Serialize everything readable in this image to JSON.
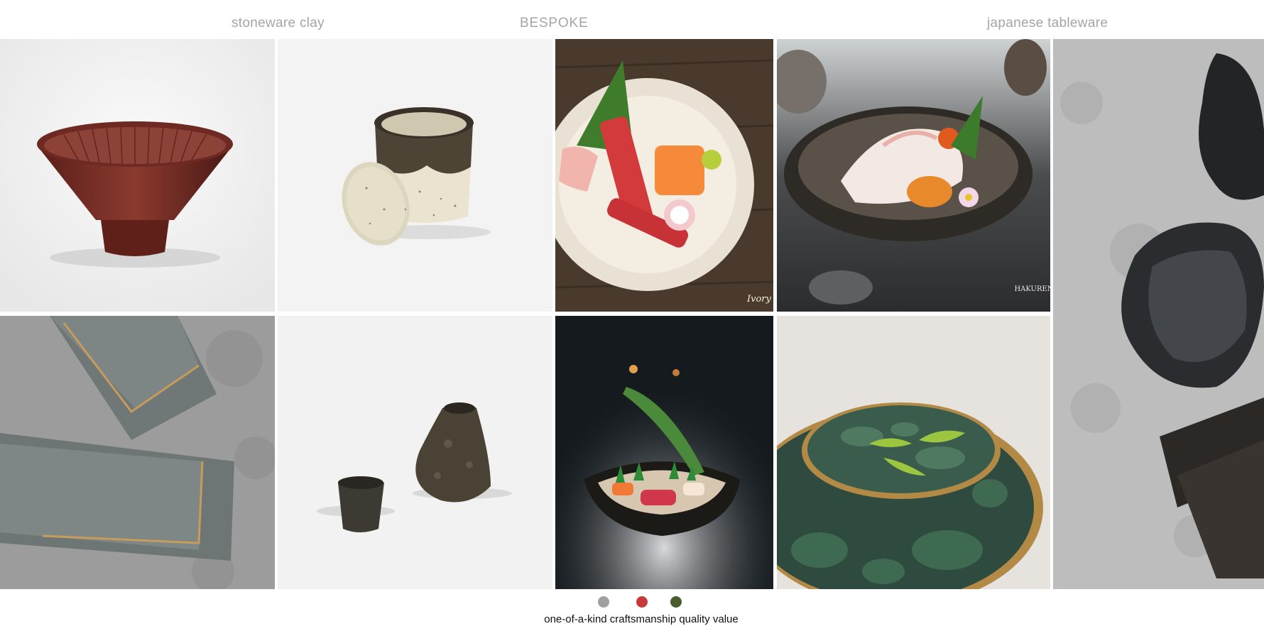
{
  "labels": {
    "left": "stoneware clay",
    "center": "BESPOKE",
    "right": "japanese tableware"
  },
  "tiles": [
    {
      "subject": "rust-red ribbed conical bowl on white"
    },
    {
      "subject": "speckled cream glazed lidded jar on white"
    },
    {
      "subject": "sashimi platter on white ribbed plate over dark wood"
    },
    {
      "subject": "sliced fish sashimi in dark stoneware bowl with flower"
    },
    {
      "subject": "dark glossy scalloped dishes on grey concrete"
    },
    {
      "subject": "grey rectangular trays with gold rims on concrete"
    },
    {
      "subject": "rough dark stoneware cup and vase on white"
    },
    {
      "subject": "sushi in rugged black bowl with smoke"
    },
    {
      "subject": "green mottled glazed plates with edamame"
    }
  ],
  "signature": "Ivory",
  "brand_mark": "HAKUREN",
  "legend": {
    "text": "one-of-a-kind craftsmanship quality value",
    "dots": [
      {
        "color": "#9ea09f"
      },
      {
        "color": "#c53b3b"
      },
      {
        "color": "#4b5d2c"
      }
    ]
  }
}
